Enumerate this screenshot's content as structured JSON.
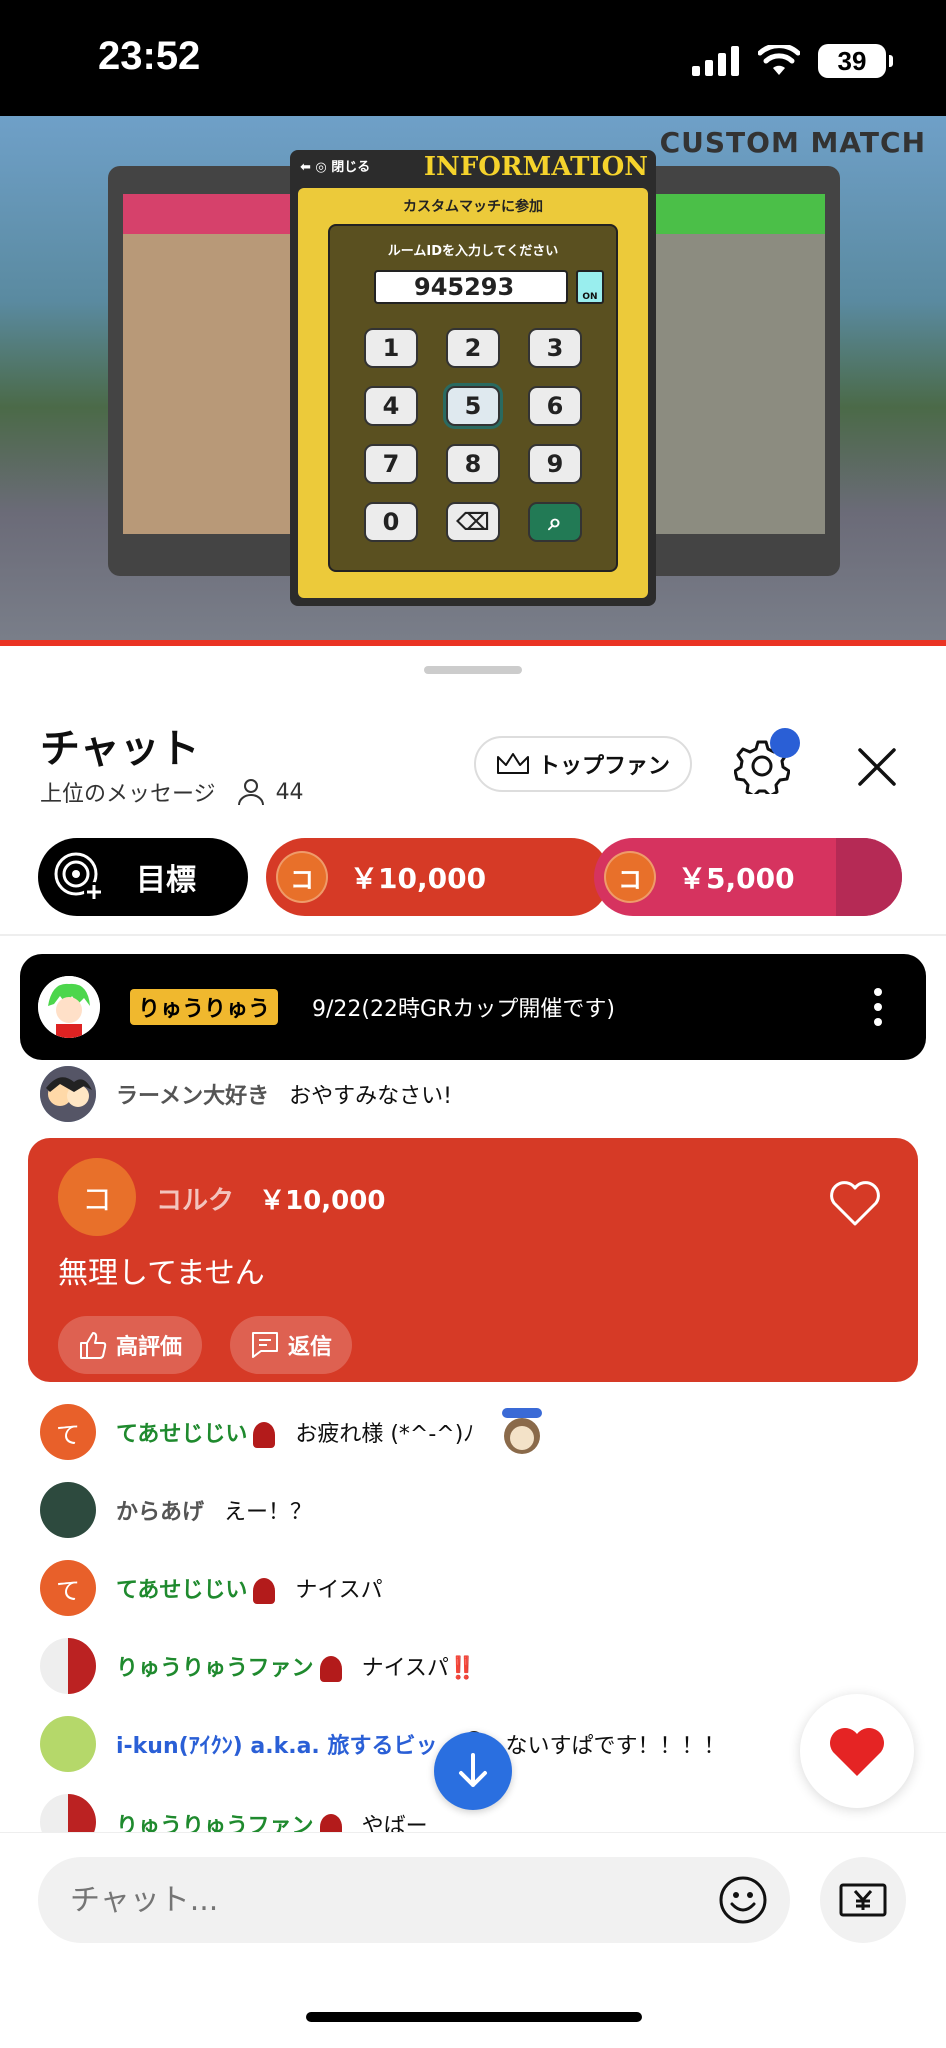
{
  "status_bar": {
    "time": "23:52",
    "battery": "39"
  },
  "video": {
    "overlay_title": "INFORMATION",
    "overlay_corner": "CUSTOM MATCH",
    "close_label": "閉じる",
    "subtitle": "カスタムマッチに参加",
    "prompt": "ルームIDを入力してください",
    "room_id": "945293",
    "eye_label": "ON",
    "keys": [
      "1",
      "2",
      "3",
      "4",
      "5",
      "6",
      "7",
      "8",
      "9",
      "0"
    ]
  },
  "chat": {
    "title": "チャット",
    "subtitle": "上位のメッセージ",
    "viewer_count": "44",
    "top_fan_label": "トップファン"
  },
  "tickers": {
    "goal_label": "目標",
    "items": [
      {
        "avatar": "コ",
        "amount": "￥10,000",
        "color": "#d63a26"
      },
      {
        "avatar": "コ",
        "amount": "￥5,000",
        "color": "#d6335f"
      }
    ]
  },
  "pinned": {
    "name": "りゅうりゅう",
    "message": "9/22(22時GRカップ開催です)"
  },
  "messages_top": [
    {
      "name": "ラーメン大好き",
      "text": "おやすみなさい!"
    }
  ],
  "superchat": {
    "avatar": "コ",
    "name": "コルク",
    "amount": "￥10,000",
    "message": "無理してません",
    "like_label": "高評価",
    "reply_label": "返信"
  },
  "messages": [
    {
      "avatar": "て",
      "name": "てあせじじい",
      "text": "お疲れ様 (*^-^)ﾉ",
      "color": "green"
    },
    {
      "avatar": "",
      "name": "からあげ",
      "text": "えー！？",
      "color": "gray"
    },
    {
      "avatar": "て",
      "name": "てあせじじい",
      "text": "ナイスパ",
      "color": "green"
    },
    {
      "avatar": "",
      "name": "りゅうりゅうファン",
      "text": "ナイスパ‼️",
      "color": "green"
    },
    {
      "avatar": "",
      "name": "i-kun(ｱｲｸﾝ) a.k.a. 旅するビッ",
      "text": "ないすぱです！！！！",
      "color": "blue"
    },
    {
      "avatar": "",
      "name": "りゅうりゅうファン",
      "text": "やばー",
      "color": "green"
    }
  ],
  "input": {
    "placeholder": "チャット..."
  },
  "colors": {
    "accent_red": "#d63a26",
    "accent_blue": "#2a6fe0",
    "settings_dot": "#2a5fd6"
  }
}
